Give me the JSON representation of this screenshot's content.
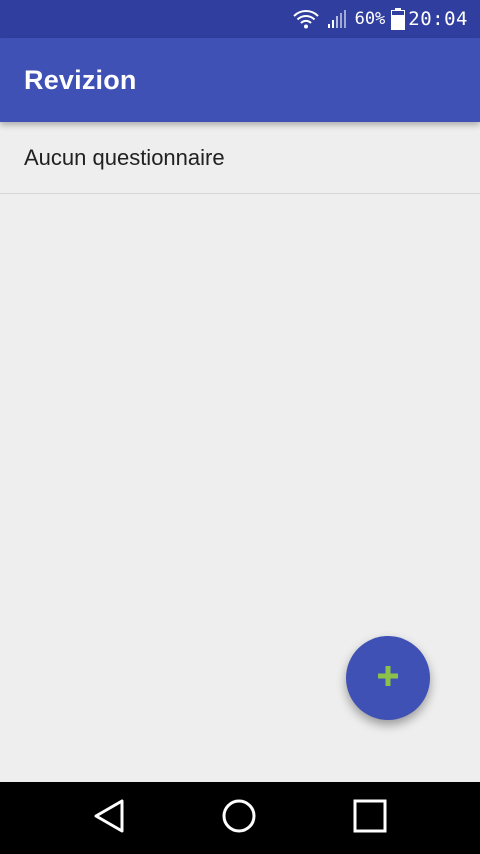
{
  "status_bar": {
    "battery_percent": "60%",
    "time": "20:04",
    "icons": [
      "wifi-icon",
      "signal-icon",
      "battery-icon"
    ]
  },
  "app_bar": {
    "title": "Revizion"
  },
  "list": {
    "items": [
      {
        "label": "Aucun questionnaire"
      }
    ]
  },
  "fab": {
    "icon": "plus-icon",
    "background": "#3f51b5",
    "icon_color": "#8bc34a"
  },
  "nav_bar": {
    "buttons": [
      "back-icon",
      "home-icon",
      "recents-icon"
    ]
  },
  "colors": {
    "primary": "#3f51b5",
    "primary_dark": "#303f9f",
    "accent": "#8bc34a",
    "background": "#eeeeee"
  }
}
